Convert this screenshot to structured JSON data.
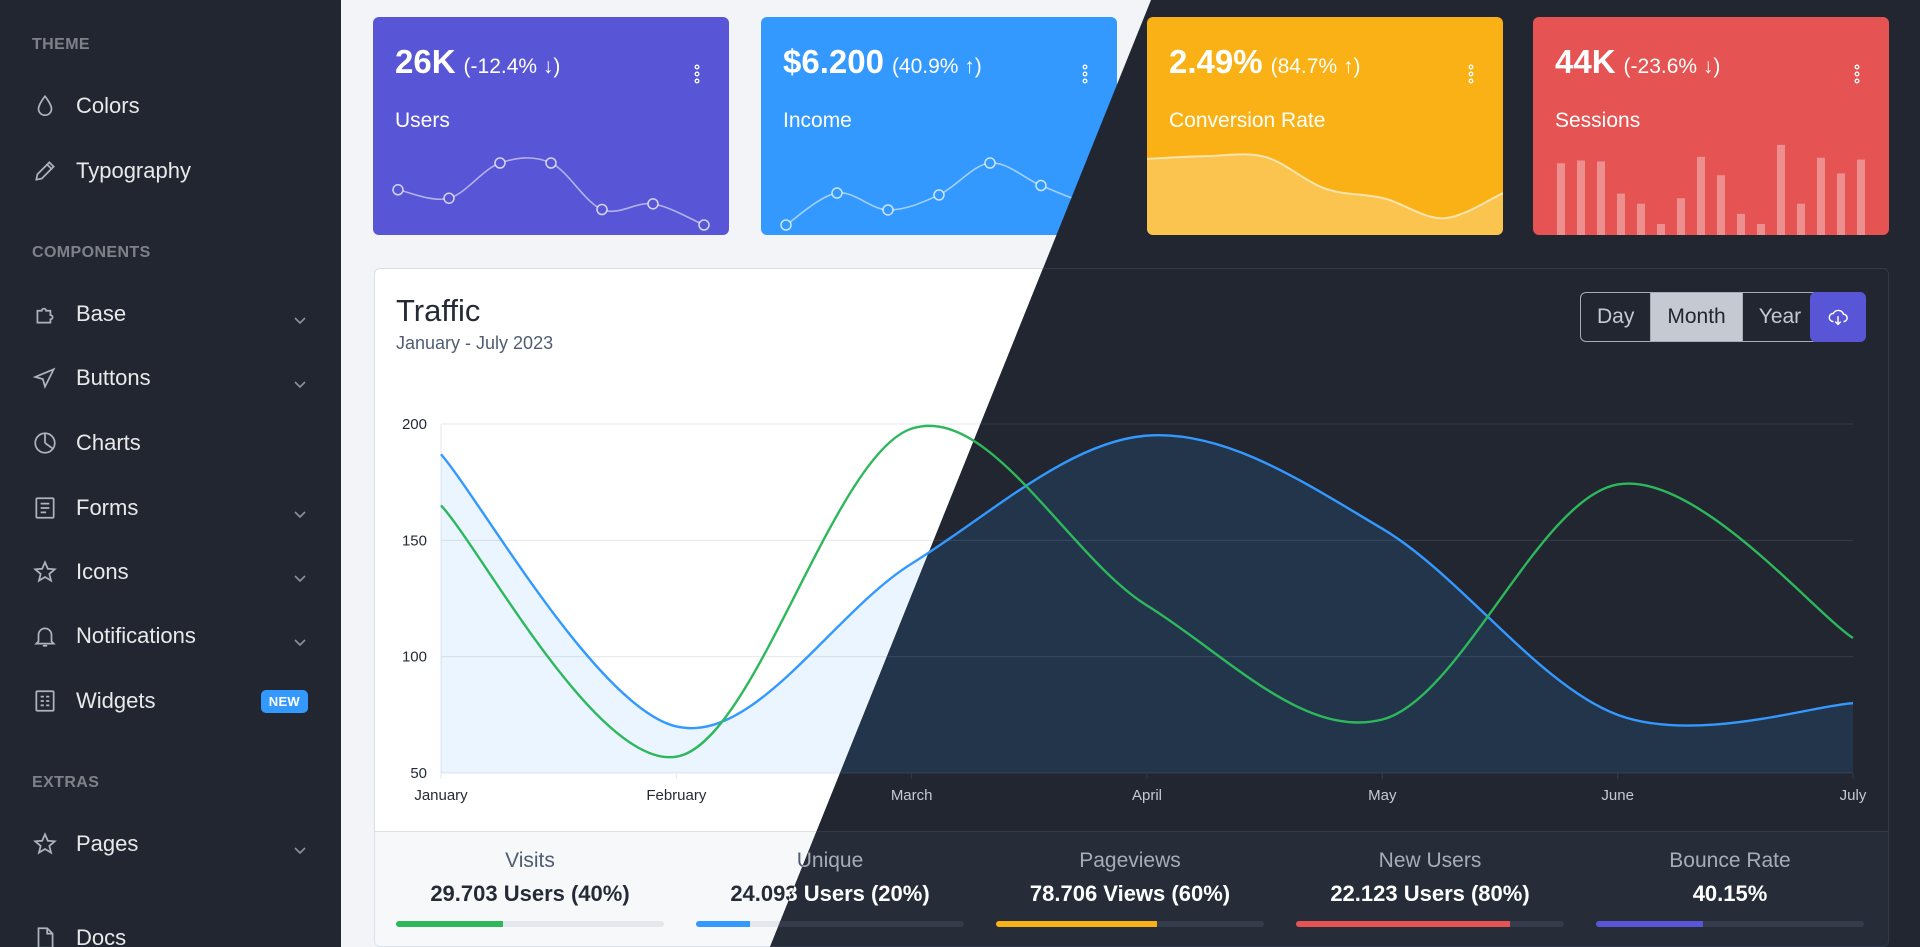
{
  "sidebar": {
    "sections": [
      {
        "title": "THEME"
      },
      {
        "title": "COMPONENTS"
      },
      {
        "title": "EXTRAS"
      }
    ],
    "items": [
      {
        "label": "Colors",
        "icon": "drop-icon"
      },
      {
        "label": "Typography",
        "icon": "pencil-icon"
      },
      {
        "label": "Base",
        "icon": "puzzle-icon",
        "has_submenu": true
      },
      {
        "label": "Buttons",
        "icon": "cursor-icon",
        "has_submenu": true
      },
      {
        "label": "Charts",
        "icon": "chart-pie-icon"
      },
      {
        "label": "Forms",
        "icon": "notes-icon",
        "has_submenu": true
      },
      {
        "label": "Icons",
        "icon": "star-icon",
        "has_submenu": true
      },
      {
        "label": "Notifications",
        "icon": "bell-icon",
        "has_submenu": true
      },
      {
        "label": "Widgets",
        "icon": "calculator-icon",
        "badge": "NEW"
      },
      {
        "label": "Pages",
        "icon": "star-icon",
        "has_submenu": true
      },
      {
        "label": "Docs",
        "icon": "description-icon"
      }
    ]
  },
  "cards": [
    {
      "value": "26K",
      "change": "(-12.4% ↓)",
      "label": "Users",
      "color": "#5856d6",
      "spark": "line",
      "points": [
        65,
        59,
        84,
        84,
        51,
        55,
        40
      ]
    },
    {
      "value": "$6.200",
      "change": "(40.9% ↑)",
      "label": "Income",
      "color": "#3399ff",
      "spark": "line",
      "points": [
        1,
        18,
        9,
        17,
        34,
        22,
        11
      ]
    },
    {
      "value": "2.49%",
      "change": "(84.7% ↑)",
      "label": "Conversion Rate",
      "color": "#f9b115",
      "spark": "area",
      "points": [
        78,
        81,
        80,
        45,
        34,
        12,
        40
      ]
    },
    {
      "value": "44K",
      "change": "(-23.6% ↓)",
      "label": "Sessions",
      "color": "#e55353",
      "spark": "bar",
      "points": [
        78,
        81,
        80,
        45,
        34,
        12,
        40,
        85,
        65,
        23,
        12,
        98,
        34,
        84,
        67,
        82
      ]
    }
  ],
  "traffic": {
    "title": "Traffic",
    "subtitle": "January - July 2023",
    "periods": [
      "Day",
      "Month",
      "Year"
    ],
    "active_period": "Month",
    "download_icon": "cloud-download-icon"
  },
  "chart_data": {
    "type": "line",
    "categories": [
      "January",
      "February",
      "March",
      "April",
      "May",
      "June",
      "July"
    ],
    "ylim": [
      50,
      200
    ],
    "yticks": [
      50,
      100,
      150,
      200
    ],
    "grid": true,
    "series": [
      {
        "color": "#3399ff",
        "fill": true,
        "values": [
          187,
          70,
          140,
          195,
          155,
          75,
          80
        ]
      },
      {
        "color": "#2eb85c",
        "fill": false,
        "values": [
          165,
          57,
          198,
          122,
          73,
          174,
          108
        ]
      }
    ]
  },
  "stats": [
    {
      "label": "Visits",
      "value": "29.703 Users (40%)",
      "percent": 40,
      "color": "#2eb85c"
    },
    {
      "label": "Unique",
      "value": "24.093 Users (20%)",
      "percent": 20,
      "color": "#3399ff"
    },
    {
      "label": "Pageviews",
      "value": "78.706 Views (60%)",
      "percent": 60,
      "color": "#f9b115"
    },
    {
      "label": "New Users",
      "value": "22.123 Users (80%)",
      "percent": 80,
      "color": "#e55353"
    },
    {
      "label": "Bounce Rate",
      "value": "40.15%",
      "percent": 40,
      "color": "#5856d6"
    }
  ]
}
